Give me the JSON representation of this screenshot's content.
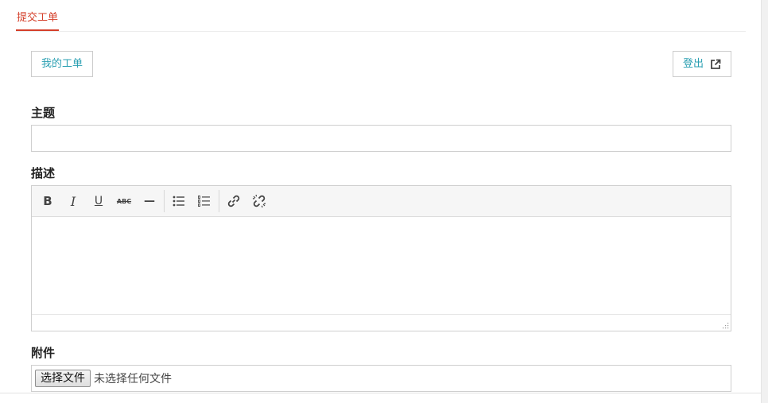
{
  "tabs": {
    "active_label": "提交工单"
  },
  "header": {
    "my_tickets_label": "我的工单",
    "logout_label": "登出"
  },
  "form": {
    "subject_label": "主题",
    "subject_value": "",
    "description_label": "描述",
    "attachment_label": "附件",
    "choose_file_label": "选择文件",
    "no_file_text": "未选择任何文件"
  },
  "toolbar": {
    "bold": "B",
    "italic": "I",
    "underline": "U",
    "strikethrough": "ABC",
    "horizontal_rule": "—"
  },
  "colors": {
    "accent_red": "#d43f2a",
    "link_teal": "#2a9fb2",
    "border": "#cfcfcf"
  },
  "icons": [
    "external-link-icon",
    "bold-icon",
    "italic-icon",
    "underline-icon",
    "strikethrough-icon",
    "horizontal-rule-icon",
    "bullet-list-icon",
    "numbered-list-icon",
    "link-icon",
    "unlink-icon",
    "resize-handle-icon"
  ]
}
